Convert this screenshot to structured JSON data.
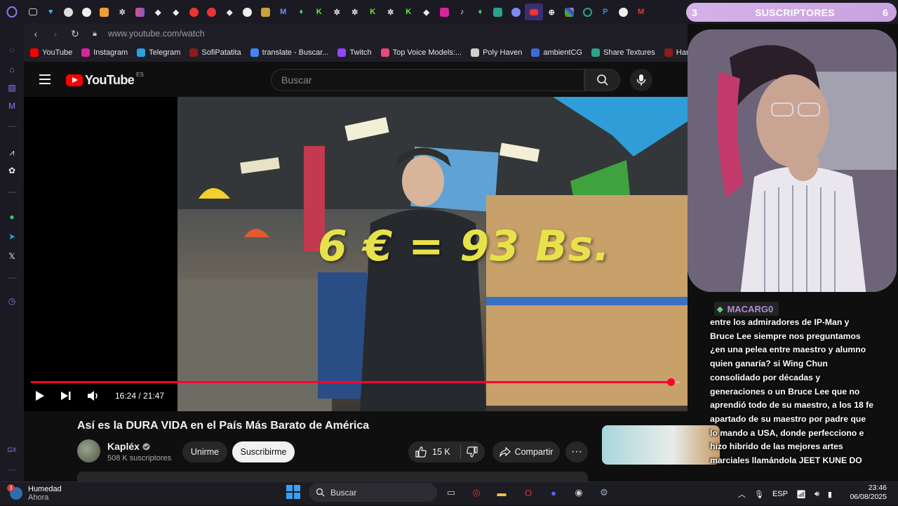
{
  "browser": {
    "url": "www.youtube.com/watch",
    "tabs_count_label": "6",
    "bookmarks": [
      {
        "label": "YouTube",
        "color": "#ff0000"
      },
      {
        "label": "Instagram",
        "color": "#d6249f"
      },
      {
        "label": "Telegram",
        "color": "#2aa3de"
      },
      {
        "label": "SofiPatatita",
        "color": "#8b1d1d"
      },
      {
        "label": "translate - Buscar...",
        "color": "#4285f4"
      },
      {
        "label": "Twitch",
        "color": "#9146ff"
      },
      {
        "label": "Top Voice Models:...",
        "color": "#e34b7a"
      },
      {
        "label": "Poly Haven",
        "color": "#cfcfcf"
      },
      {
        "label": "ambientCG",
        "color": "#3c6bd6"
      },
      {
        "label": "Share Textures",
        "color": "#2aa38a"
      },
      {
        "label": "Har",
        "color": "#8b1d1d"
      }
    ]
  },
  "youtube": {
    "logo_text": "YouTube",
    "region": "ES",
    "search_placeholder": "Buscar",
    "video": {
      "overlay_text": "6 € = 93 Bs.",
      "time": "16:24 / 21:47",
      "progress": 0.986,
      "title": "Así es la DURA VIDA en el País Más Barato de América"
    },
    "channel": {
      "name": "Kapléx",
      "subscribers": "508 K suscriptores"
    },
    "actions": {
      "join": "Unirme",
      "subscribe": "Suscribirme",
      "likes": "15 K",
      "share": "Compartir"
    }
  },
  "stream_overlay": {
    "sub_count": "3",
    "sub_label": "SUSCRIPTORES",
    "sub_goal": "6",
    "chat_user": "MACARG0",
    "chat_message": "entre los admiradores de IP-Man y Bruce Lee siempre nos preguntamos ¿en una pelea entre maestro y alumno quien ganaría? si Wing Chun consolidado por décadas y generaciones o un Bruce Lee que no aprendió todo de su maestro, a los 18 fe apartado de su maestro por padre que lo mando a USA, donde perfecciono e hizo hibrido de las mejores artes marciales llamándola JEET KUNE DO"
  },
  "taskbar": {
    "weather_title": "Humedad",
    "weather_sub": "Ahora",
    "weather_badge": "3",
    "search_placeholder": "Buscar",
    "lang": "ESP",
    "time": "23:46",
    "date": "06/08/2025"
  }
}
